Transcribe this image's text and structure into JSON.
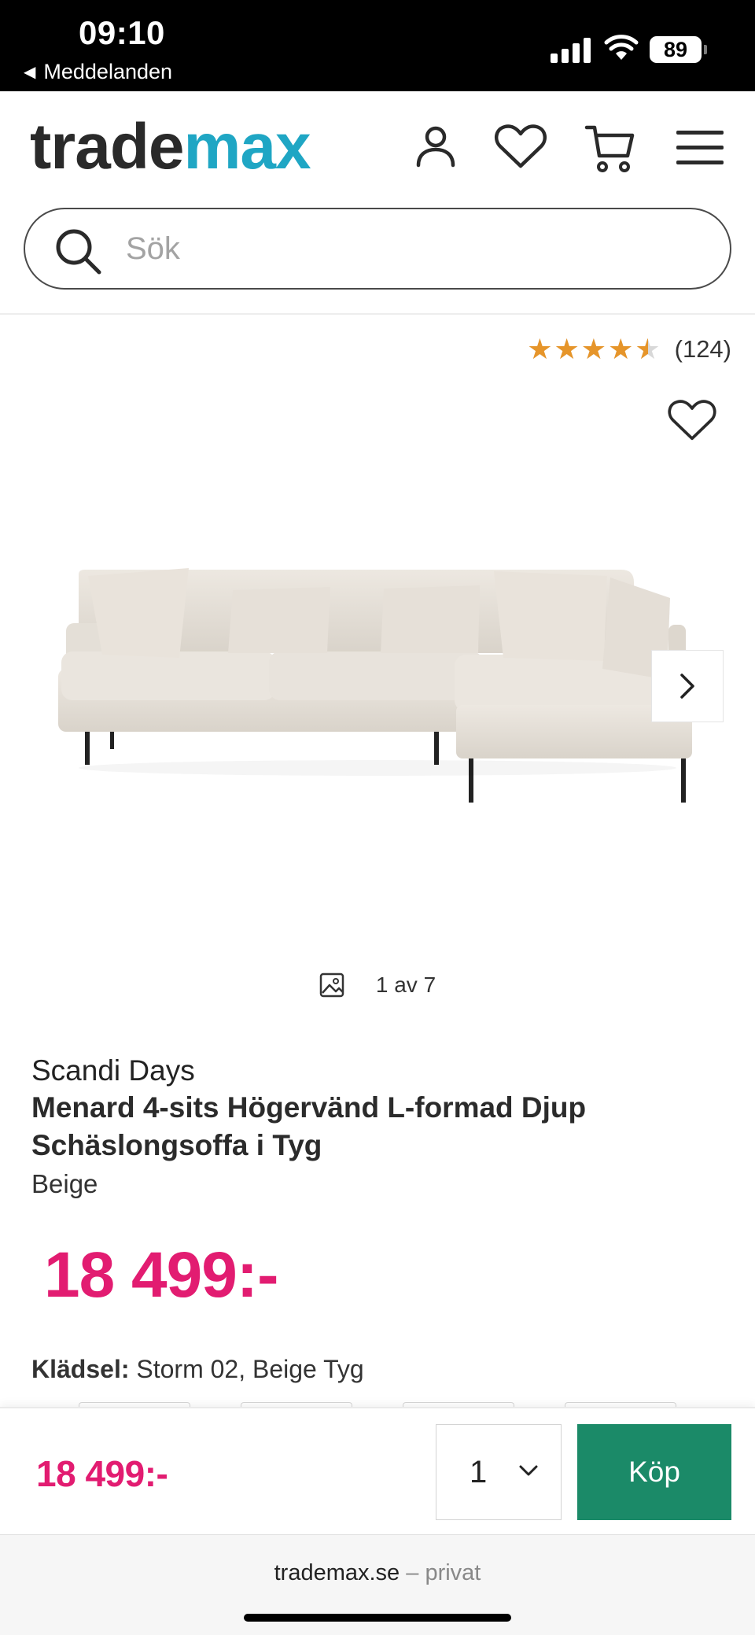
{
  "status_bar": {
    "time": "09:10",
    "back_label": "Meddelanden",
    "battery": "89"
  },
  "header": {
    "logo_part1": "trade",
    "logo_part2": "max",
    "logo_colors": {
      "part1": "#2a2a2a",
      "part2": "#1fa6c4"
    },
    "icons": [
      "account-icon",
      "heart-icon",
      "cart-icon",
      "menu-icon"
    ]
  },
  "search": {
    "placeholder": "Sök"
  },
  "rating": {
    "value": 4.5,
    "max": 5,
    "count": "(124)"
  },
  "gallery": {
    "counter": "1 av 7"
  },
  "product": {
    "brand": "Scandi Days",
    "title": "Menard 4-sits Högervänd L-formad Djup Schäslongsoffa i Tyg",
    "color": "Beige",
    "price": "18 499:-",
    "upholstery_label": "Klädsel:",
    "upholstery_value": "Storm 02, Beige Tyg"
  },
  "buy_bar": {
    "price": "18 499:-",
    "quantity": "1",
    "buy_label": "Köp",
    "buy_color": "#1b8a68",
    "price_color": "#e21c71"
  },
  "browser": {
    "domain": "trademax.se",
    "separator": "–",
    "mode": "privat"
  }
}
